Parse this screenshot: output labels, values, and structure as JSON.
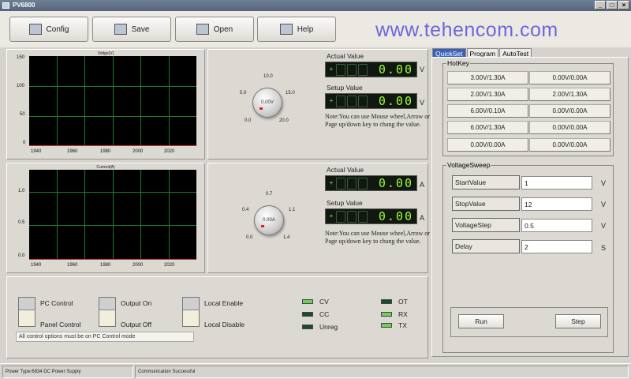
{
  "window": {
    "title": "PV6800"
  },
  "watermark": "www.tehencom.com",
  "toolbar": {
    "config": "Config",
    "save": "Save",
    "open": "Open",
    "help": "Help"
  },
  "voltage_chart": {
    "title": "Voltge(V)",
    "yticks": [
      "150",
      "100",
      "50",
      "0"
    ],
    "xticks": [
      "1940",
      "1960",
      "1980",
      "2000",
      "2020"
    ]
  },
  "current_chart": {
    "title": "Current(A)",
    "yticks": [
      "1.0",
      "0.5",
      "0.0"
    ],
    "xticks": [
      "1940",
      "1960",
      "1980",
      "2000",
      "2020"
    ]
  },
  "voltage_dial": {
    "value": "0.00V",
    "scale": {
      "s1": "10.0",
      "s2": "5.0",
      "s3": "15.0",
      "s4": "0.0",
      "s5": "20.0"
    }
  },
  "current_dial": {
    "value": "0.00A",
    "scale": {
      "s1": "0.7",
      "s2": "0.4",
      "s3": "1.1",
      "s4": "0.0",
      "s5": "1.4"
    }
  },
  "voltage_display": {
    "actual_label": "Actual Value",
    "actual_value": "0.00",
    "setup_label": "Setup Value",
    "setup_value": "0.00",
    "unit": "V",
    "sign": "+"
  },
  "current_display": {
    "actual_label": "Actual Value",
    "actual_value": "0.00",
    "setup_label": "Setup Value",
    "setup_value": "0.00",
    "unit": "A",
    "sign": "+"
  },
  "note": "Note:You can use Mouse wheel,Arrow or Page up/down key to chang the value.",
  "tabs": [
    "QuickSet",
    "Program",
    "AutoTest"
  ],
  "hotkey": {
    "title": "HotKey",
    "items": [
      "3.00V/1.30A",
      "0.00V/0.00A",
      "2.00V/1.30A",
      "2.00V/1.30A",
      "6.00V/0.10A",
      "0.00V/0.00A",
      "6.00V/1.30A",
      "0.00V/0.00A",
      "0.00V/0.00A",
      "0.00V/0.00A"
    ]
  },
  "voltage_sweep": {
    "title": "VoltageSweep",
    "start_label": "StartValue",
    "start_value": "1",
    "start_unit": "V",
    "step_label": "StopValue",
    "step_value": "12",
    "step_unit": "V",
    "vstep_label": "VoltageStep",
    "vstep_value": "0.5",
    "vstep_unit": "V",
    "delay_label": "Delay",
    "delay_value": "2",
    "delay_unit": "S",
    "run": "Run",
    "step": "Step"
  },
  "controls": {
    "pc_control": "PC Control",
    "panel_control": "Panel Control",
    "output_on": "Output On",
    "output_off": "Output Off",
    "local_enable": "Local Enable",
    "local_disable": "Local Disable",
    "info": "All control options must be on PC Control mode"
  },
  "leds": {
    "cv": "CV",
    "cc": "CC",
    "unreg": "Unreg",
    "ot": "OT",
    "rx": "RX",
    "tx": "TX",
    "colors": {
      "on": "#6fcf4f",
      "off": "#1d4a2a"
    }
  },
  "status": {
    "left": "Power Type:6834 DC Power Supply",
    "right": "Communication Successful"
  }
}
